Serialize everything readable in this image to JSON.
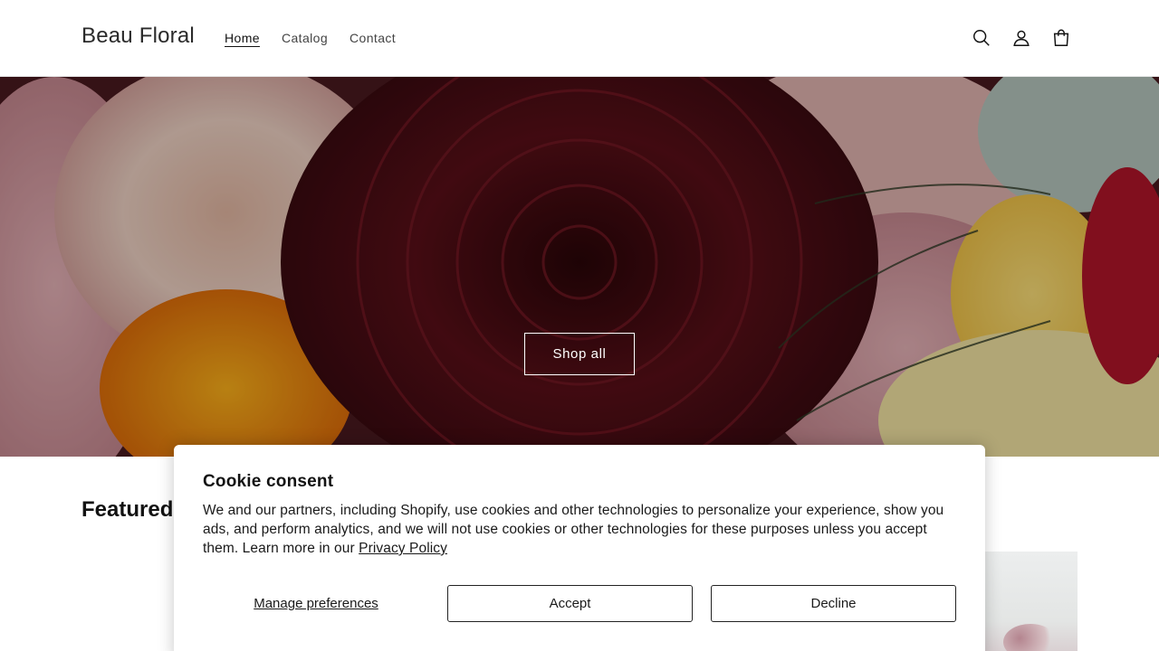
{
  "header": {
    "logo": "Beau Floral",
    "nav": [
      {
        "label": "Home",
        "active": true
      },
      {
        "label": "Catalog",
        "active": false
      },
      {
        "label": "Contact",
        "active": false
      }
    ],
    "icons": [
      "search-icon",
      "account-icon",
      "cart-icon"
    ]
  },
  "hero": {
    "button_label": "Shop all"
  },
  "featured": {
    "title": "Featured p"
  },
  "cookie": {
    "title": "Cookie consent",
    "body": "We and our partners, including Shopify, use cookies and other technologies to personalize your experience, show you ads, and perform analytics, and we will not use cookies or other technologies for these purposes unless you accept them. Learn more in our ",
    "link": "Privacy Policy",
    "manage_label": "Manage preferences",
    "accept_label": "Accept",
    "decline_label": "Decline"
  },
  "colors": {
    "text": "#121212",
    "border": "#222222",
    "hero_dark": "#3a1116"
  }
}
